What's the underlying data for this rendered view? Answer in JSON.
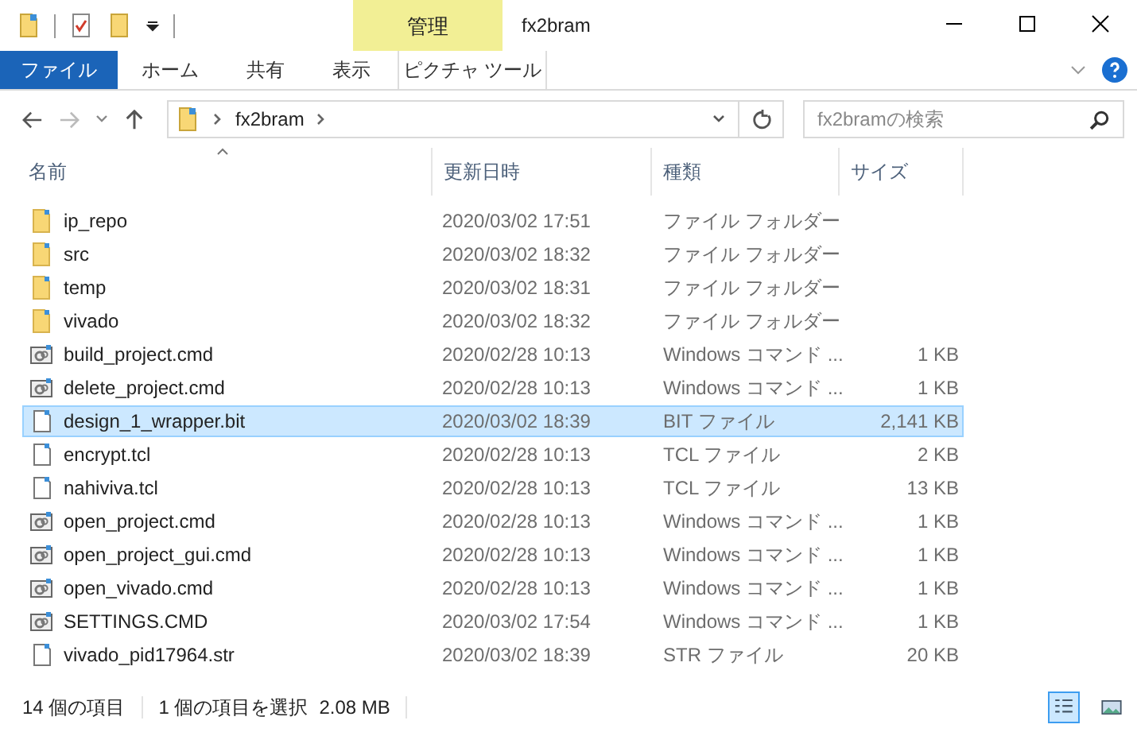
{
  "window": {
    "title": "fx2bram",
    "tool_tab": "管理"
  },
  "ribbon_tabs": [
    {
      "label": "ファイル",
      "kind": "file",
      "selected": false
    },
    {
      "label": "ホーム",
      "kind": "tab",
      "selected": false
    },
    {
      "label": "共有",
      "kind": "tab",
      "selected": false
    },
    {
      "label": "表示",
      "kind": "tab",
      "selected": false
    },
    {
      "label": "ピクチャ ツール",
      "kind": "tool",
      "selected": false
    }
  ],
  "address": {
    "crumbs": [
      "fx2bram"
    ]
  },
  "search": {
    "placeholder": "fx2bramの検索"
  },
  "columns": [
    {
      "label": "名前"
    },
    {
      "label": "更新日時"
    },
    {
      "label": "種類"
    },
    {
      "label": "サイズ"
    }
  ],
  "rows": [
    {
      "kind": "folder",
      "name": "ip_repo",
      "date": "2020/03/02 17:51",
      "type": "ファイル フォルダー",
      "selected": false
    },
    {
      "kind": "folder",
      "name": "src",
      "date": "2020/03/02 18:32",
      "type": "ファイル フォルダー",
      "selected": false
    },
    {
      "kind": "folder",
      "name": "temp",
      "date": "2020/03/02 18:31",
      "type": "ファイル フォルダー",
      "selected": false
    },
    {
      "kind": "folder",
      "name": "vivado",
      "date": "2020/03/02 18:32",
      "type": "ファイル フォルダー",
      "selected": false
    },
    {
      "kind": "cmd",
      "name": "build_project.cmd",
      "date": "2020/02/28 10:13",
      "type": "Windows コマンド ...",
      "size": "1 KB",
      "selected": false
    },
    {
      "kind": "cmd",
      "name": "delete_project.cmd",
      "date": "2020/02/28 10:13",
      "type": "Windows コマンド ...",
      "size": "1 KB",
      "selected": false
    },
    {
      "kind": "file",
      "name": "design_1_wrapper.bit",
      "date": "2020/03/02 18:39",
      "type": "BIT ファイル",
      "size": "2,141 KB",
      "selected": true
    },
    {
      "kind": "file",
      "name": "encrypt.tcl",
      "date": "2020/02/28 10:13",
      "type": "TCL ファイル",
      "size": "2 KB",
      "selected": false
    },
    {
      "kind": "file",
      "name": "nahiviva.tcl",
      "date": "2020/02/28 10:13",
      "type": "TCL ファイル",
      "size": "13 KB",
      "selected": false
    },
    {
      "kind": "cmd",
      "name": "open_project.cmd",
      "date": "2020/02/28 10:13",
      "type": "Windows コマンド ...",
      "size": "1 KB",
      "selected": false
    },
    {
      "kind": "cmd",
      "name": "open_project_gui.cmd",
      "date": "2020/02/28 10:13",
      "type": "Windows コマンド ...",
      "size": "1 KB",
      "selected": false
    },
    {
      "kind": "cmd",
      "name": "open_vivado.cmd",
      "date": "2020/02/28 10:13",
      "type": "Windows コマンド ...",
      "size": "1 KB",
      "selected": false
    },
    {
      "kind": "cmd",
      "name": "SETTINGS.CMD",
      "date": "2020/03/02 17:54",
      "type": "Windows コマンド ...",
      "size": "1 KB",
      "selected": false
    },
    {
      "kind": "file",
      "name": "vivado_pid17964.str",
      "date": "2020/03/02 18:39",
      "type": "STR ファイル",
      "size": "20 KB",
      "selected": false
    }
  ],
  "status_bar": {
    "count": "14 個の項目",
    "selection": "1 個の項目を選択",
    "selection_size": "2.08 MB"
  },
  "views": [
    {
      "kind": "details",
      "selected": true
    },
    {
      "kind": "tiles",
      "selected": false
    }
  ]
}
